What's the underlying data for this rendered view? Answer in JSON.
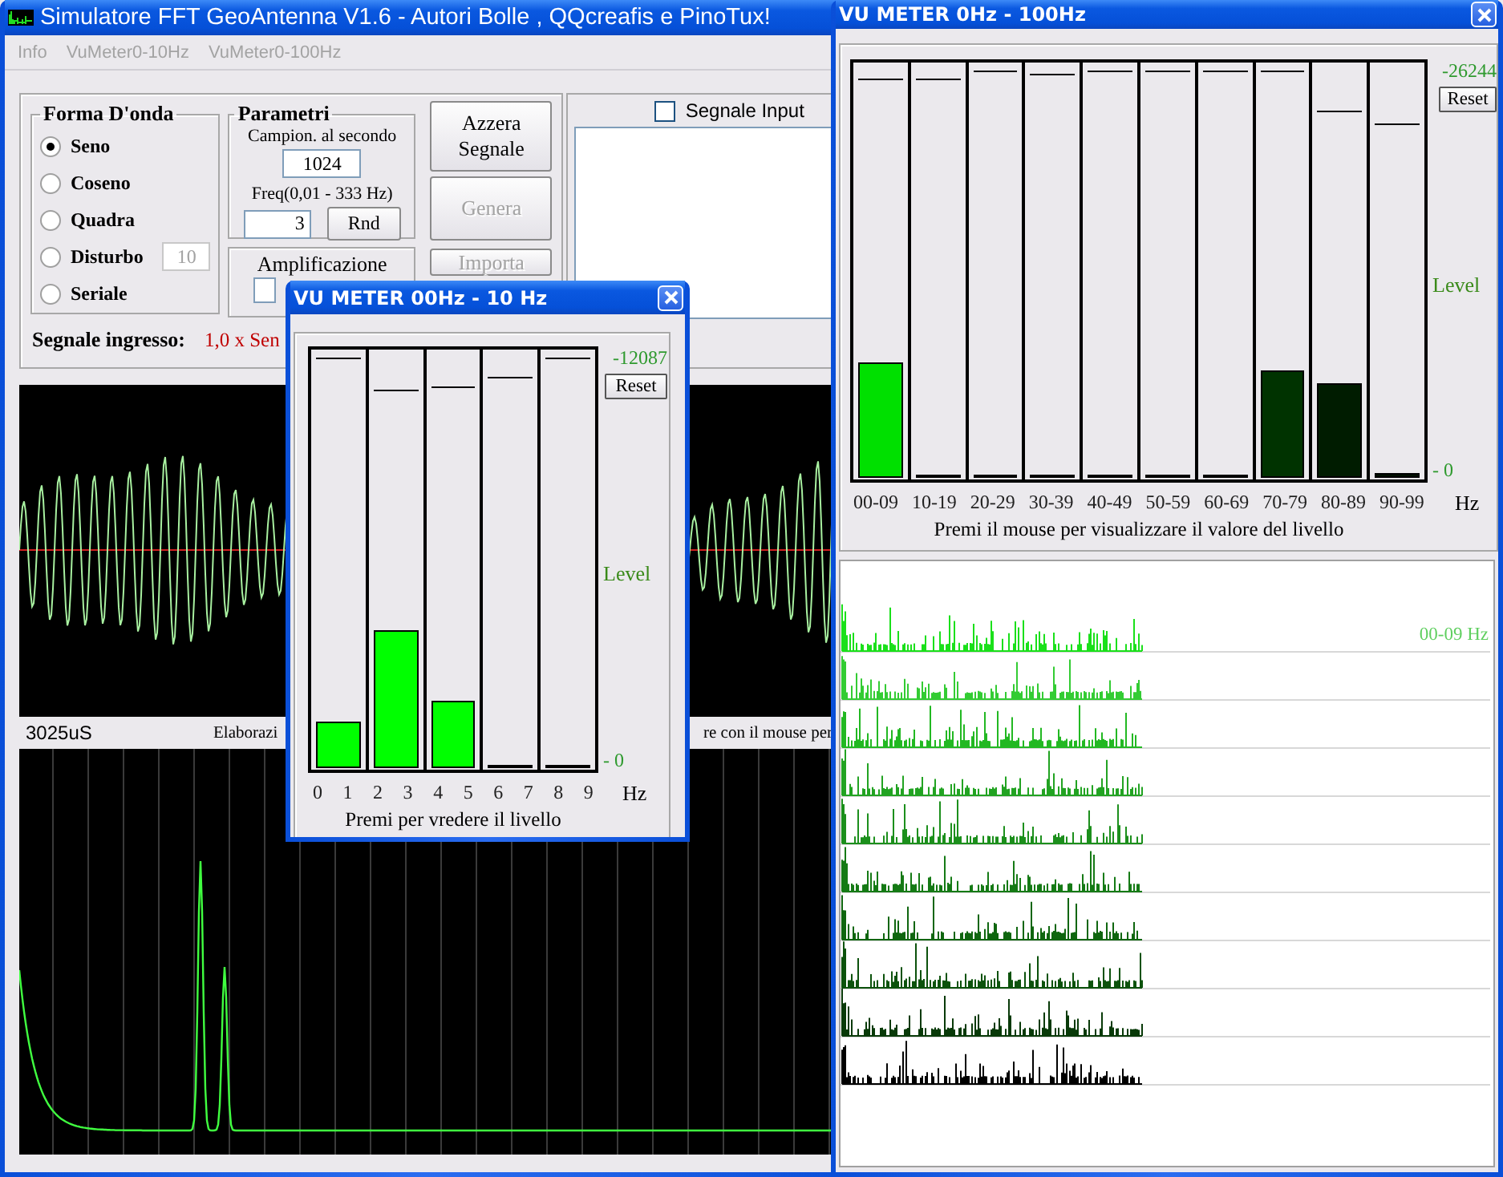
{
  "main_window": {
    "title": "Simulatore FFT GeoAntenna V1.6 - Autori Bolle , QQcreafis e PinoTux!",
    "menu": [
      {
        "label": "Info",
        "disabled": true
      },
      {
        "label": "VuMeter0-10Hz",
        "disabled": true
      },
      {
        "label": "VuMeter0-100Hz",
        "disabled": true
      }
    ],
    "waveform_group": {
      "title": "Forma D'onda",
      "options": [
        {
          "label": "Seno",
          "selected": true
        },
        {
          "label": "Coseno",
          "selected": false
        },
        {
          "label": "Quadra",
          "selected": false
        },
        {
          "label": "Disturbo",
          "selected": false
        },
        {
          "label": "Seriale",
          "selected": false
        }
      ],
      "noise_field": {
        "value": "10",
        "disabled": true
      }
    },
    "parameters": {
      "title": "Parametri",
      "sample_rate_label": "Campion. al secondo",
      "sample_rate": "1024",
      "freq_label": "Freq(0,01 - 333  Hz)",
      "freq": "3",
      "random_button": "Rnd"
    },
    "amplification": {
      "title": "Amplificazione"
    },
    "buttons": [
      {
        "label": "Azzera Segnale",
        "disabled": false
      },
      {
        "label": "Genera",
        "disabled": true
      },
      {
        "label": "Importa",
        "disabled": true
      }
    ],
    "input_checkbox": {
      "label": "Segnale Input",
      "checked": false
    },
    "input_signal": {
      "label": "Segnale ingresso:",
      "value": "1,0 x Sen"
    },
    "status": {
      "time": "3025uS",
      "message_start": "Elaborazi",
      "message_end": "re con il mouse per"
    }
  },
  "vu_meter_10hz": {
    "title": "VU METER 00Hz - 10 Hz",
    "max_label": "-12087",
    "reset_button": "Reset",
    "level_label": "Level",
    "zero_label": "- 0",
    "bars": [
      {
        "level": 0.11,
        "color": "#00ff00",
        "peak": {
          "level": 0.99
        }
      },
      {
        "level": 0.33,
        "color": "#00ff00",
        "peak": {
          "level": 0.91
        }
      },
      {
        "level": 0.16,
        "color": "#00ff00",
        "peak": {
          "level": 0.92
        }
      },
      {
        "level": 0.005,
        "peak": {
          "level": 0.94
        }
      },
      {
        "level": 0,
        "peak": {
          "level": 0.99
        }
      }
    ],
    "axis_labels": [
      "0",
      "1",
      "2",
      "3",
      "4",
      "5",
      "6",
      "7",
      "8",
      "9"
    ],
    "unit": "Hz",
    "caption": "Premi per vredere il livello"
  },
  "vu_meter_100hz": {
    "title": "VU METER 0Hz - 100Hz",
    "max_label": "-26244",
    "reset_button": "Reset",
    "level_label": "Level",
    "zero_label": "- 0",
    "bars": [
      {
        "level": 0.28,
        "color": "#00e000",
        "peak": {
          "level": 0.97
        }
      },
      {
        "level": 0,
        "peak": {
          "level": 0.97
        }
      },
      {
        "level": 0,
        "peak": {
          "level": 0.99
        }
      },
      {
        "level": 0,
        "peak": {
          "level": 0.98
        }
      },
      {
        "level": 0,
        "peak": {
          "level": 0.99
        }
      },
      {
        "level": 0,
        "peak": {
          "level": 0.99
        }
      },
      {
        "level": 0,
        "peak": {
          "level": 0.99
        }
      },
      {
        "level": 0.26,
        "color": "#003300",
        "peak": {
          "level": 0.99
        }
      },
      {
        "level": 0.23,
        "color": "#001c00",
        "peak": {
          "level": 0.89
        }
      },
      {
        "level": 0.01,
        "color": "#001000",
        "peak": {
          "level": 0.86
        }
      }
    ],
    "axis_labels": [
      "00-09",
      "10-19",
      "20-29",
      "30-39",
      "40-49",
      "50-59",
      "60-69",
      "70-79",
      "80-89",
      "90-99"
    ],
    "unit": "Hz",
    "caption": "Premi il mouse per visualizzare il valore del livello",
    "history": {
      "label": "00-09 Hz",
      "traces": [
        {
          "color": "#1ae01a"
        },
        {
          "color": "#33cc33"
        },
        {
          "color": "#22b822"
        },
        {
          "color": "#22a322"
        },
        {
          "color": "#1c8f1c"
        },
        {
          "color": "#157a15"
        },
        {
          "color": "#0f660f"
        },
        {
          "color": "#0c520c"
        },
        {
          "color": "#093a09"
        },
        {
          "color": "#000000"
        }
      ]
    }
  }
}
